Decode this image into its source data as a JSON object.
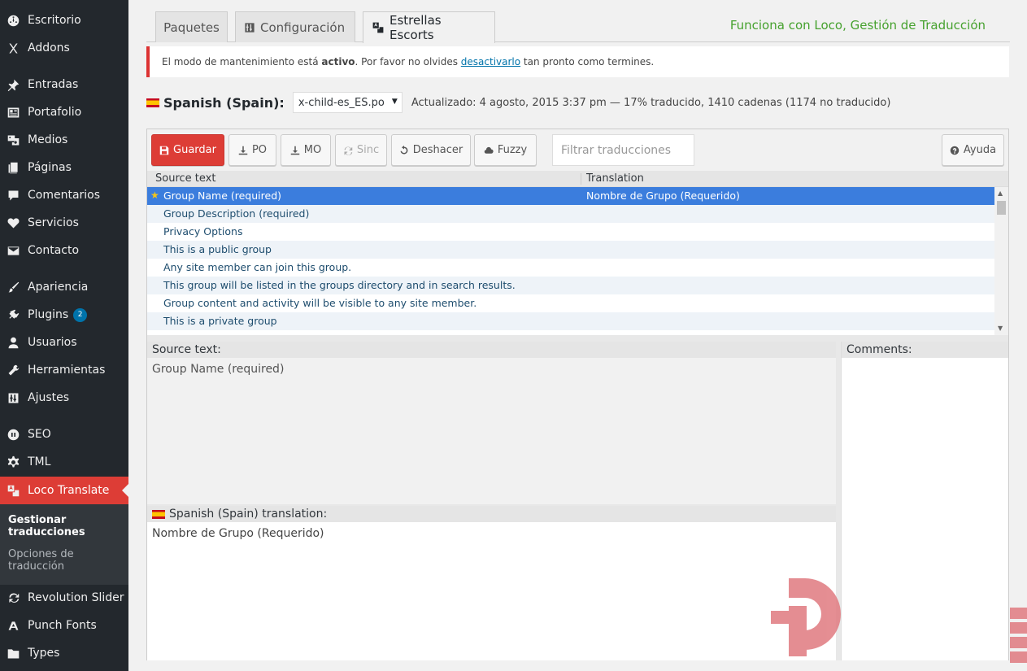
{
  "sidebar": {
    "items": [
      {
        "label": "Escritorio",
        "icon": "dashboard-icon"
      },
      {
        "label": "Addons",
        "icon": "x-icon"
      },
      {
        "label": "Entradas",
        "icon": "pin-icon"
      },
      {
        "label": "Portafolio",
        "icon": "portfolio-icon"
      },
      {
        "label": "Medios",
        "icon": "media-icon"
      },
      {
        "label": "Páginas",
        "icon": "pages-icon"
      },
      {
        "label": "Comentarios",
        "icon": "comment-icon"
      },
      {
        "label": "Servicios",
        "icon": "heart-icon"
      },
      {
        "label": "Contacto",
        "icon": "envelope-icon"
      },
      {
        "label": "Apariencia",
        "icon": "brush-icon"
      },
      {
        "label": "Plugins",
        "icon": "plugin-icon",
        "badge": "2"
      },
      {
        "label": "Usuarios",
        "icon": "user-icon"
      },
      {
        "label": "Herramientas",
        "icon": "wrench-icon"
      },
      {
        "label": "Ajustes",
        "icon": "settings-icon"
      },
      {
        "label": "SEO",
        "icon": "seo-icon"
      },
      {
        "label": "TML",
        "icon": "gear-icon"
      },
      {
        "label": "Loco Translate",
        "icon": "translate-icon",
        "current": true
      },
      {
        "label": "Revolution Slider",
        "icon": "refresh-icon"
      },
      {
        "label": "Punch Fonts",
        "icon": "font-icon"
      },
      {
        "label": "Types",
        "icon": "folder-icon"
      }
    ],
    "submenu": [
      {
        "label": "Gestionar traducciones",
        "active": true
      },
      {
        "label": "Opciones de traducción",
        "active": false
      }
    ]
  },
  "tabs": [
    {
      "label": "Paquetes",
      "icon": ""
    },
    {
      "label": "Configuración",
      "icon": "sliders-icon"
    },
    {
      "label": "Estrellas Escorts",
      "icon": "translate-icon",
      "active": true
    }
  ],
  "powered_by": "Funciona con Loco, Gestión de Traducción",
  "notice": {
    "text_before": "El modo de mantenimiento está ",
    "bold": "activo",
    "text_middle": ". Por favor no olvides ",
    "link": "desactivarlo",
    "text_after": " tan pronto como termines."
  },
  "file": {
    "language": "Spanish (Spain):",
    "selected_file": "x-child-es_ES.po",
    "meta": "Actualizado: 4 agosto, 2015 3:37 pm — 17% traducido, 1410 cadenas (1174 no traducido)"
  },
  "toolbar": {
    "save": "Guardar",
    "po": "PO",
    "mo": "MO",
    "sync": "Sinc",
    "revert": "Deshacer",
    "fuzzy": "Fuzzy",
    "filter_placeholder": "Filtrar traducciones",
    "help": "Ayuda"
  },
  "list": {
    "col_source": "Source text",
    "col_translation": "Translation",
    "rows": [
      {
        "source": "Group Name (required)",
        "translation": "Nombre de Grupo (Requerido)",
        "selected": true,
        "starred": true
      },
      {
        "source": "Group Description (required)",
        "translation": ""
      },
      {
        "source": "Privacy Options",
        "translation": ""
      },
      {
        "source": "This is a public group",
        "translation": ""
      },
      {
        "source": "Any site member can join this group.",
        "translation": ""
      },
      {
        "source": "This group will be listed in the groups directory and in search results.",
        "translation": ""
      },
      {
        "source": "Group content and activity will be visible to any site member.",
        "translation": ""
      },
      {
        "source": "This is a private group",
        "translation": ""
      }
    ]
  },
  "source_panel": {
    "title": "Source text:",
    "text": "Group Name (required)"
  },
  "translation_panel": {
    "title": "Spanish (Spain) translation:",
    "text": "Nombre de Grupo (Requerido)"
  },
  "comments_panel": {
    "title": "Comments:"
  },
  "colors": {
    "sidebar": "#23282d",
    "accent": "#dd3d36",
    "selected_row": "#3b7ddd",
    "powered": "#46a12e"
  }
}
